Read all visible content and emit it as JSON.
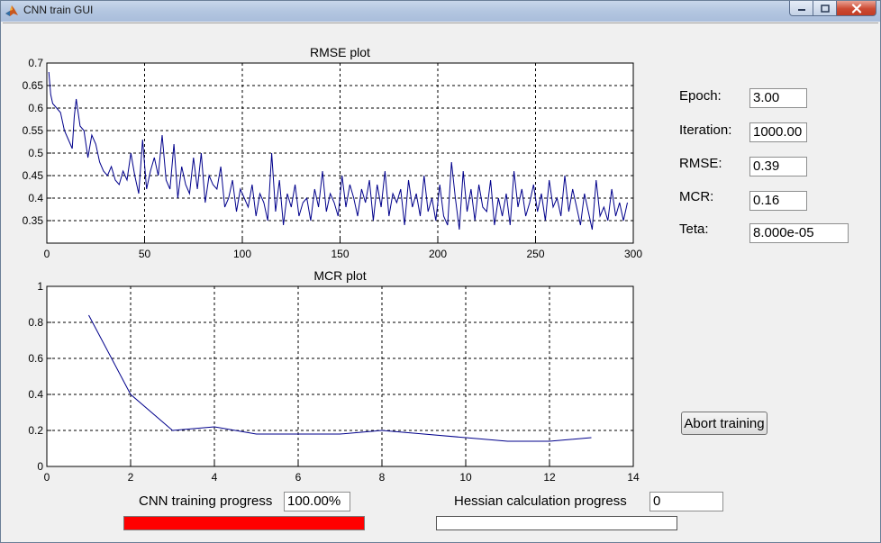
{
  "window": {
    "title": "CNN train GUI",
    "controls": {
      "minimize_icon": "minimize-icon",
      "maximize_icon": "maximize-icon",
      "close_icon": "close-icon"
    }
  },
  "stats": {
    "epoch": {
      "label": "Epoch:",
      "value": "3.00"
    },
    "iteration": {
      "label": "Iteration:",
      "value": "1000.00"
    },
    "rmse": {
      "label": "RMSE:",
      "value": "0.39"
    },
    "mcr": {
      "label": "MCR:",
      "value": "0.16"
    },
    "teta": {
      "label": "Teta:",
      "value": "8.000e-05"
    }
  },
  "abort_label": "Abort training",
  "progress": {
    "cnn": {
      "label": "CNN training progress",
      "value_text": "100.00%",
      "fraction": 1.0,
      "fill_color": "#ff0000"
    },
    "hessian": {
      "label": "Hessian calculation progress",
      "value_text": "0",
      "fraction": 0.0,
      "fill_color": "#ff0000"
    }
  },
  "colors": {
    "line": "#00008b",
    "grid": "#000000",
    "panel": "#f0f0f0"
  },
  "chart_data": [
    {
      "type": "line",
      "title": "RMSE plot",
      "xlabel": "",
      "ylabel": "",
      "xlim": [
        0,
        300
      ],
      "ylim": [
        0.3,
        0.7
      ],
      "xticks": [
        0,
        50,
        100,
        150,
        200,
        250,
        300
      ],
      "yticks": [
        0.35,
        0.4,
        0.45,
        0.5,
        0.55,
        0.6,
        0.65,
        0.7
      ],
      "xtick_labels": [
        "0",
        "50",
        "100",
        "150",
        "200",
        "250",
        "300"
      ],
      "ytick_labels": [
        "0.35",
        "0.4",
        "0.45",
        "0.5",
        "0.55",
        "0.6",
        "0.65",
        "0.7"
      ],
      "grid": true,
      "x": [
        1,
        2,
        3,
        5,
        7,
        9,
        11,
        13,
        14,
        15,
        17,
        19,
        21,
        23,
        25,
        27,
        29,
        31,
        33,
        35,
        37,
        39,
        41,
        43,
        45,
        47,
        49,
        51,
        53,
        55,
        57,
        59,
        61,
        63,
        65,
        67,
        69,
        71,
        73,
        75,
        77,
        79,
        81,
        83,
        85,
        87,
        89,
        91,
        93,
        95,
        97,
        99,
        101,
        103,
        105,
        107,
        109,
        111,
        113,
        115,
        117,
        119,
        121,
        123,
        125,
        127,
        129,
        131,
        133,
        135,
        137,
        139,
        141,
        143,
        145,
        147,
        149,
        151,
        153,
        155,
        157,
        159,
        161,
        163,
        165,
        167,
        169,
        171,
        173,
        175,
        177,
        179,
        181,
        183,
        185,
        187,
        189,
        191,
        193,
        195,
        197,
        199,
        201,
        203,
        205,
        207,
        209,
        211,
        213,
        215,
        217,
        219,
        221,
        223,
        225,
        227,
        229,
        231,
        233,
        235,
        237,
        239,
        241,
        243,
        245,
        247,
        249,
        251,
        253,
        255,
        257,
        259,
        261,
        263,
        265,
        267,
        269,
        271,
        273,
        275,
        277,
        279,
        281,
        283,
        285,
        287,
        289,
        291,
        293,
        295,
        297
      ],
      "y": [
        0.68,
        0.63,
        0.61,
        0.6,
        0.59,
        0.55,
        0.53,
        0.51,
        0.58,
        0.62,
        0.56,
        0.55,
        0.49,
        0.54,
        0.52,
        0.48,
        0.46,
        0.45,
        0.47,
        0.44,
        0.43,
        0.46,
        0.44,
        0.5,
        0.45,
        0.41,
        0.53,
        0.42,
        0.46,
        0.49,
        0.45,
        0.54,
        0.44,
        0.42,
        0.52,
        0.4,
        0.47,
        0.43,
        0.41,
        0.49,
        0.42,
        0.5,
        0.39,
        0.45,
        0.43,
        0.42,
        0.47,
        0.38,
        0.4,
        0.44,
        0.37,
        0.42,
        0.4,
        0.38,
        0.43,
        0.36,
        0.41,
        0.39,
        0.35,
        0.5,
        0.37,
        0.44,
        0.34,
        0.41,
        0.38,
        0.43,
        0.36,
        0.39,
        0.4,
        0.35,
        0.42,
        0.38,
        0.46,
        0.37,
        0.41,
        0.39,
        0.36,
        0.45,
        0.38,
        0.43,
        0.4,
        0.36,
        0.42,
        0.39,
        0.44,
        0.35,
        0.43,
        0.38,
        0.46,
        0.36,
        0.41,
        0.39,
        0.42,
        0.34,
        0.44,
        0.38,
        0.41,
        0.36,
        0.45,
        0.37,
        0.4,
        0.35,
        0.43,
        0.36,
        0.34,
        0.48,
        0.4,
        0.33,
        0.46,
        0.37,
        0.42,
        0.35,
        0.43,
        0.38,
        0.37,
        0.44,
        0.34,
        0.4,
        0.36,
        0.41,
        0.34,
        0.46,
        0.38,
        0.42,
        0.36,
        0.39,
        0.43,
        0.37,
        0.41,
        0.35,
        0.44,
        0.38,
        0.4,
        0.36,
        0.45,
        0.37,
        0.42,
        0.38,
        0.34,
        0.41,
        0.37,
        0.33,
        0.44,
        0.36,
        0.38,
        0.35,
        0.42,
        0.36,
        0.39,
        0.35,
        0.39
      ]
    },
    {
      "type": "line",
      "title": "MCR plot",
      "xlabel": "",
      "ylabel": "",
      "xlim": [
        0,
        14
      ],
      "ylim": [
        0,
        1
      ],
      "xticks": [
        0,
        2,
        4,
        6,
        8,
        10,
        12,
        14
      ],
      "yticks": [
        0,
        0.2,
        0.4,
        0.6,
        0.8,
        1
      ],
      "xtick_labels": [
        "0",
        "2",
        "4",
        "6",
        "8",
        "10",
        "12",
        "14"
      ],
      "ytick_labels": [
        "0",
        "0.2",
        "0.4",
        "0.6",
        "0.8",
        "1"
      ],
      "grid": true,
      "x": [
        1,
        2,
        3,
        4,
        5,
        6,
        7,
        8,
        9,
        10,
        11,
        12,
        13
      ],
      "y": [
        0.84,
        0.4,
        0.2,
        0.22,
        0.18,
        0.18,
        0.18,
        0.2,
        0.18,
        0.16,
        0.14,
        0.14,
        0.16
      ]
    }
  ]
}
